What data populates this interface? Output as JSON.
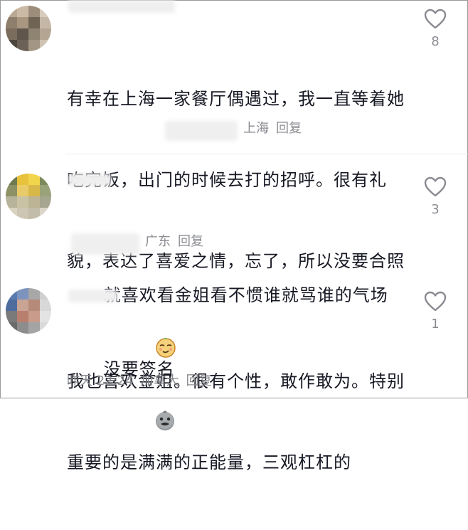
{
  "comments": [
    {
      "text_lines": [
        "有幸在上海一家餐厅偶遇过，我一直等着她",
        "吃完饭，出门的时候去打的招呼。很有礼",
        "貌，表达了喜爱之情，忘了，所以没要合照",
        "没要签名"
      ],
      "location": "上海",
      "reply_label": "回复",
      "likes": "8",
      "emoji": "grimace-face-emoji"
    },
    {
      "text_lines": [
        "就喜欢看金姐看不惯谁就骂谁的气场"
      ],
      "location": "广东",
      "reply_label": "回复",
      "likes": "3",
      "emoji": "smug-face-emoji"
    },
    {
      "text_lines": [
        "我也喜欢金姐。很有个性，敢作敢为。特别",
        "重要的是满满的正能量，三观杠杠的"
      ],
      "time": "昨天 22:24",
      "location": "加拿大",
      "reply_label": "回复",
      "likes": "1"
    }
  ],
  "colors": {
    "text": "#161823",
    "meta": "#8a8b91",
    "heart_outline": "#8a8b91"
  }
}
